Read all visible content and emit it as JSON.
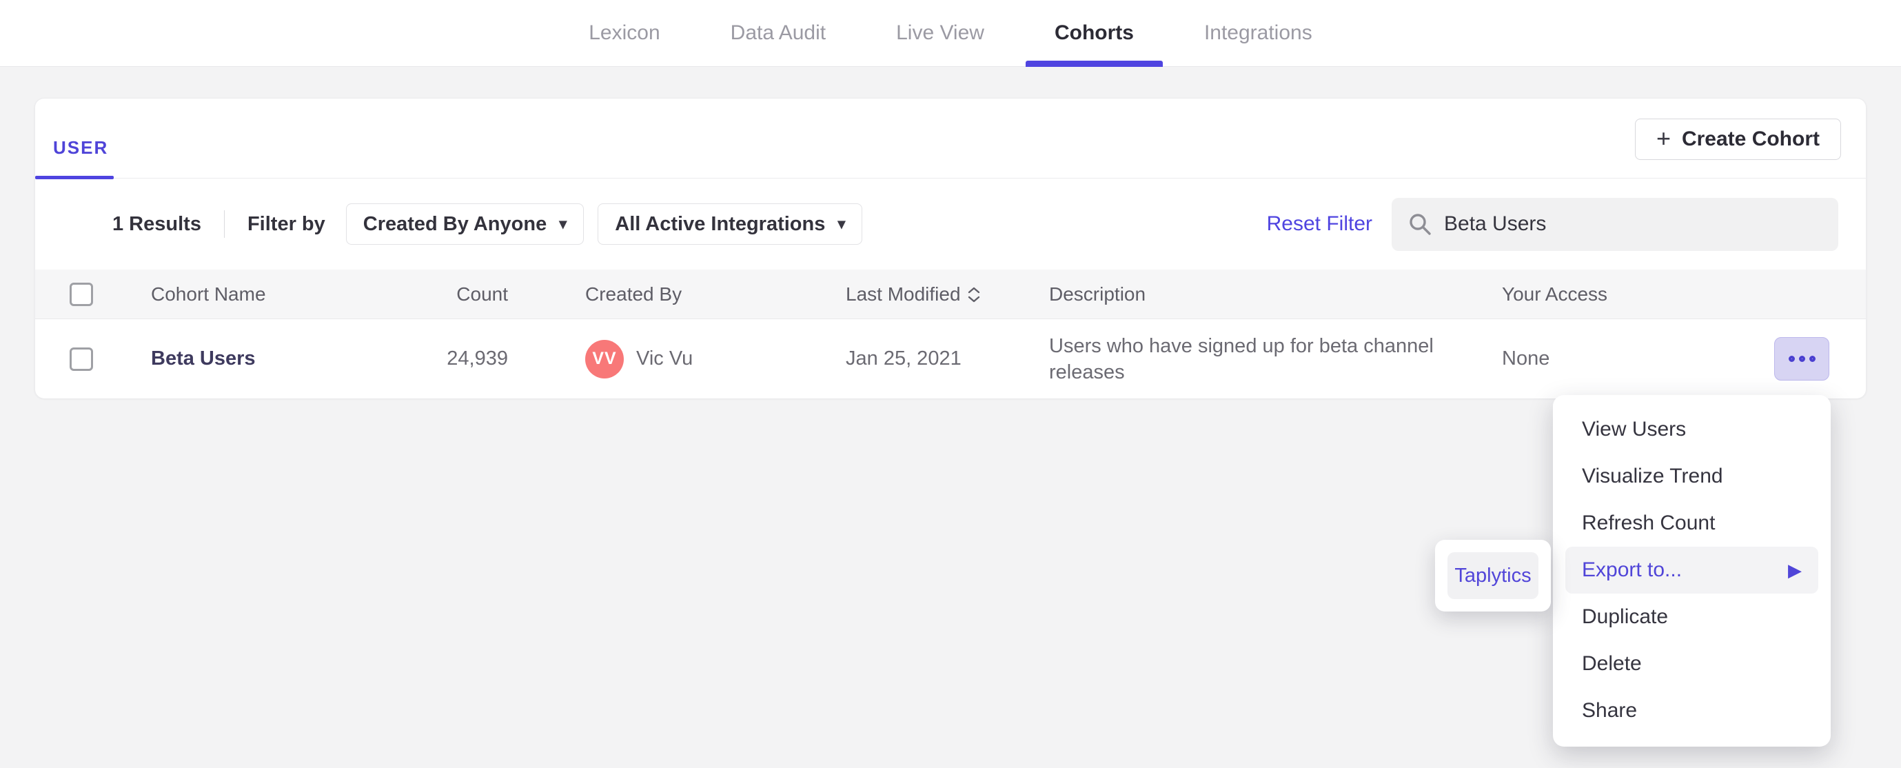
{
  "nav": {
    "tabs": [
      {
        "label": "Lexicon",
        "active": false
      },
      {
        "label": "Data Audit",
        "active": false
      },
      {
        "label": "Live View",
        "active": false
      },
      {
        "label": "Cohorts",
        "active": true
      },
      {
        "label": "Integrations",
        "active": false
      }
    ]
  },
  "card": {
    "type_tab_label": "USER",
    "create_button_label": "Create Cohort",
    "filters": {
      "results_count": "1 Results",
      "filter_by_label": "Filter by",
      "created_by_dropdown": "Created By Anyone",
      "integrations_dropdown": "All Active Integrations",
      "reset_link": "Reset Filter",
      "search_value": "Beta Users"
    },
    "table": {
      "headers": {
        "name": "Cohort Name",
        "count": "Count",
        "created_by": "Created By",
        "last_modified": "Last Modified",
        "description": "Description",
        "access": "Your Access"
      },
      "rows": [
        {
          "name": "Beta Users",
          "count": "24,939",
          "avatar_initials": "VV",
          "created_by": "Vic Vu",
          "last_modified": "Jan 25, 2021",
          "description": "Users who have signed up for beta channel releases",
          "access": "None"
        }
      ]
    }
  },
  "context_menu": {
    "items": [
      {
        "label": "View Users",
        "highlighted": false
      },
      {
        "label": "Visualize Trend",
        "highlighted": false
      },
      {
        "label": "Refresh Count",
        "highlighted": false
      },
      {
        "label": "Export to...",
        "highlighted": true,
        "has_submenu": true
      },
      {
        "label": "Duplicate",
        "highlighted": false
      },
      {
        "label": "Delete",
        "highlighted": false
      },
      {
        "label": "Share",
        "highlighted": false
      }
    ]
  },
  "export_submenu": {
    "items": [
      {
        "label": "Taplytics"
      }
    ]
  },
  "colors": {
    "accent_purple": "#4f44e0",
    "avatar_coral": "#f87878",
    "cohort_name_navy": "#3e3a5e",
    "ellipsis_button_bg": "#d7d4f3",
    "page_background": "#f3f3f4",
    "menu_highlight": "#f3f3f5"
  }
}
